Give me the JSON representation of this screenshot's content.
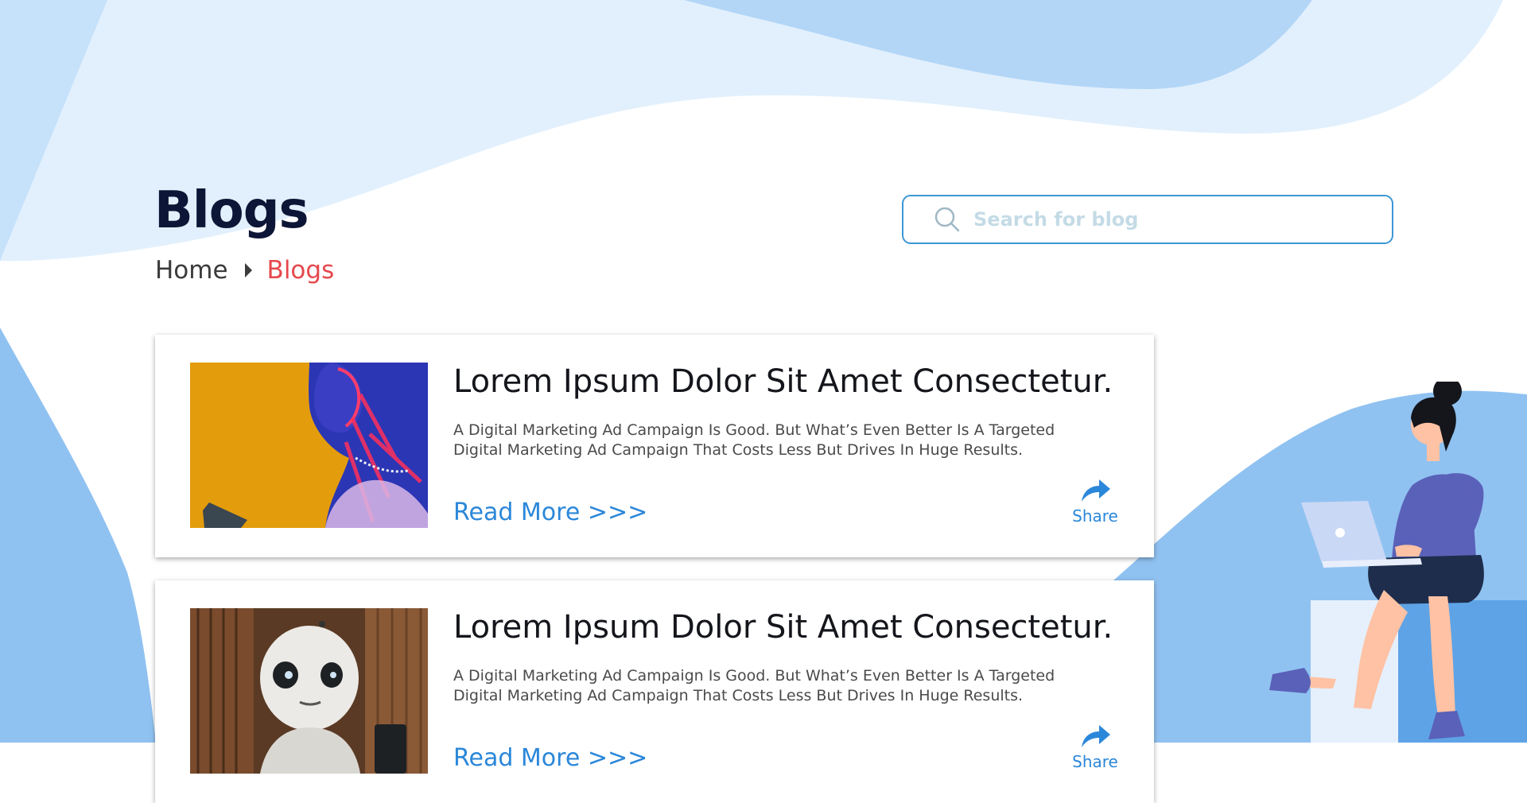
{
  "page": {
    "title": "Blogs",
    "breadcrumb": {
      "home": "Home",
      "current": "Blogs"
    }
  },
  "search": {
    "placeholder": "Search for blog",
    "value": ""
  },
  "blogs": [
    {
      "title": "Lorem Ipsum Dolor Sit Amet Consectetur.",
      "description": "A Digital Marketing Ad Campaign Is Good. But What’s Even Better Is A Targeted Digital Marketing Ad Campaign That Costs Less But Drives In Huge Results.",
      "read_more": "Read More >>>",
      "share": "Share",
      "image": "portrait-neon-light"
    },
    {
      "title": "Lorem Ipsum Dolor Sit Amet Consectetur.",
      "description": "A Digital Marketing Ad Campaign Is Good. But What’s Even Better Is A Targeted Digital Marketing Ad Campaign That Costs Less But Drives In Huge Results.",
      "read_more": "Read More >>>",
      "share": "Share",
      "image": "robot"
    }
  ],
  "colors": {
    "title": "#0d1636",
    "breadcrumb_active": "#e5484d",
    "accent": "#2b87d9",
    "search_border": "#3d97d6",
    "background_wave_light": "#ddeefd",
    "background_wave_mid": "#b3d6f7",
    "background_wave_side": "#90c2f1"
  }
}
